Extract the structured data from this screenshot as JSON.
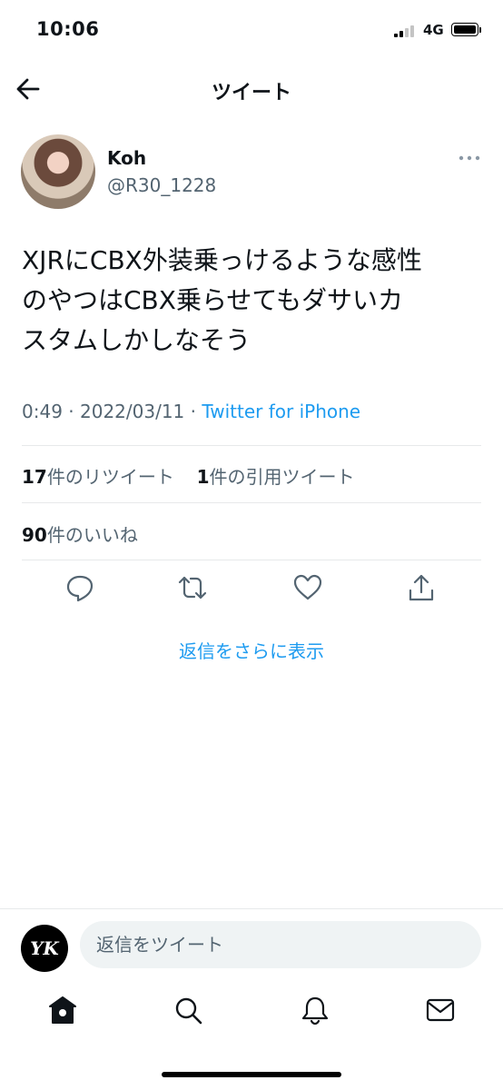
{
  "status_bar": {
    "time": "10:06",
    "network": "4G"
  },
  "header": {
    "title": "ツイート",
    "back_icon": "back-arrow-icon"
  },
  "tweet": {
    "author_name": "Koh",
    "author_handle": "@R30_1228",
    "text_lines": [
      "XJRにCBX外装乗っけるような感性",
      "のやつはCBX乗らせてもダサいカ",
      "スタムしかしなそう"
    ],
    "time": "0:49",
    "date": "2022/03/11",
    "source": "Twitter for iPhone",
    "retweet_count": "17",
    "retweet_label": "件のリツイート",
    "quote_count": "1",
    "quote_label": "件の引用ツイート",
    "like_count": "90",
    "like_label": "件のいいね"
  },
  "actions": [
    "reply-icon",
    "retweet-icon",
    "like-icon",
    "share-icon"
  ],
  "more_replies_label": "返信をさらに表示",
  "reply_bar": {
    "avatar_text": "YK",
    "placeholder": "返信をツイート"
  },
  "tabs": [
    "home-icon",
    "search-icon",
    "notifications-icon",
    "messages-icon"
  ],
  "colors": {
    "accent": "#1d9bf0",
    "secondary_text": "#536471",
    "divider": "#e7e9ea"
  }
}
